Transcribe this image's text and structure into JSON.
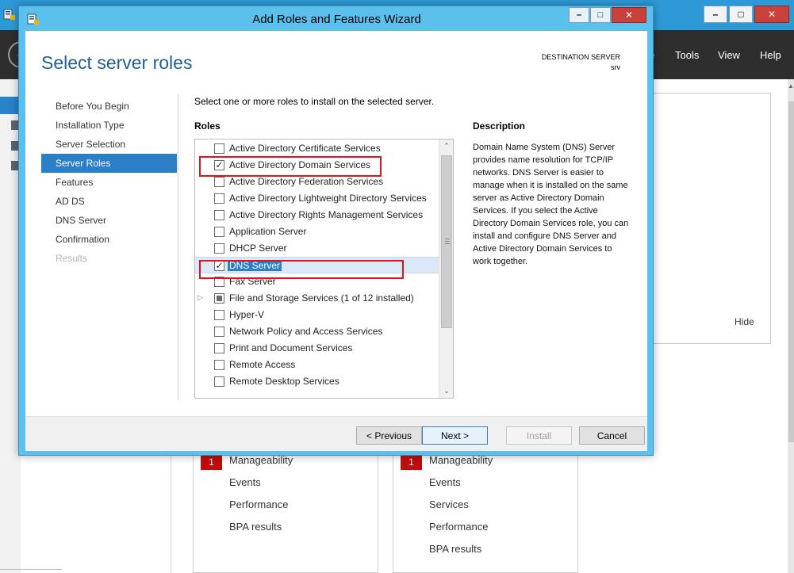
{
  "background_window": {
    "menu": [
      "e",
      "Tools",
      "View",
      "Help"
    ],
    "welcome_hide": "Hide",
    "tiles": [
      {
        "badge": "1",
        "items": [
          "Manageability",
          "Events",
          "Performance",
          "BPA results"
        ]
      },
      {
        "badge": "1",
        "items": [
          "Manageability",
          "Events",
          "Services",
          "Performance",
          "BPA results"
        ]
      }
    ]
  },
  "wizard": {
    "title": "Add Roles and Features Wizard",
    "heading": "Select server roles",
    "destination_label": "DESTINATION SERVER",
    "destination_server": "srv",
    "nav": [
      {
        "label": "Before You Begin",
        "state": "normal"
      },
      {
        "label": "Installation Type",
        "state": "normal"
      },
      {
        "label": "Server Selection",
        "state": "normal"
      },
      {
        "label": "Server Roles",
        "state": "selected"
      },
      {
        "label": "Features",
        "state": "normal"
      },
      {
        "label": "AD DS",
        "state": "normal"
      },
      {
        "label": "DNS Server",
        "state": "normal"
      },
      {
        "label": "Confirmation",
        "state": "normal"
      },
      {
        "label": "Results",
        "state": "disabled"
      }
    ],
    "instruction": "Select one or more roles to install on the selected server.",
    "roles_label": "Roles",
    "roles": [
      {
        "label": "Active Directory Certificate Services",
        "checked": false
      },
      {
        "label": "Active Directory Domain Services",
        "checked": true,
        "annotated": true
      },
      {
        "label": "Active Directory Federation Services",
        "checked": false
      },
      {
        "label": "Active Directory Lightweight Directory Services",
        "checked": false
      },
      {
        "label": "Active Directory Rights Management Services",
        "checked": false
      },
      {
        "label": "Application Server",
        "checked": false
      },
      {
        "label": "DHCP Server",
        "checked": false
      },
      {
        "label": "DNS Server",
        "checked": true,
        "selected": true,
        "annotated": true
      },
      {
        "label": "Fax Server",
        "checked": false
      },
      {
        "label": "File and Storage Services (1 of 12 installed)",
        "checked": "partial",
        "expandable": true
      },
      {
        "label": "Hyper-V",
        "checked": false
      },
      {
        "label": "Network Policy and Access Services",
        "checked": false
      },
      {
        "label": "Print and Document Services",
        "checked": false
      },
      {
        "label": "Remote Access",
        "checked": false
      },
      {
        "label": "Remote Desktop Services",
        "checked": false
      }
    ],
    "description_title": "Description",
    "description_text": "Domain Name System (DNS) Server provides name resolution for TCP/IP networks. DNS Server is easier to manage when it is installed on the same server as Active Directory Domain Services. If you select the Active Directory Domain Services role, you can install and configure DNS Server and Active Directory Domain Services to work together.",
    "buttons": {
      "previous": "< Previous",
      "next": "Next >",
      "install": "Install",
      "cancel": "Cancel"
    },
    "colors": {
      "frame": "#5bc0ec",
      "heading": "#1f5f93",
      "selection": "#2b7fc7",
      "annotation": "#e0141e"
    }
  }
}
